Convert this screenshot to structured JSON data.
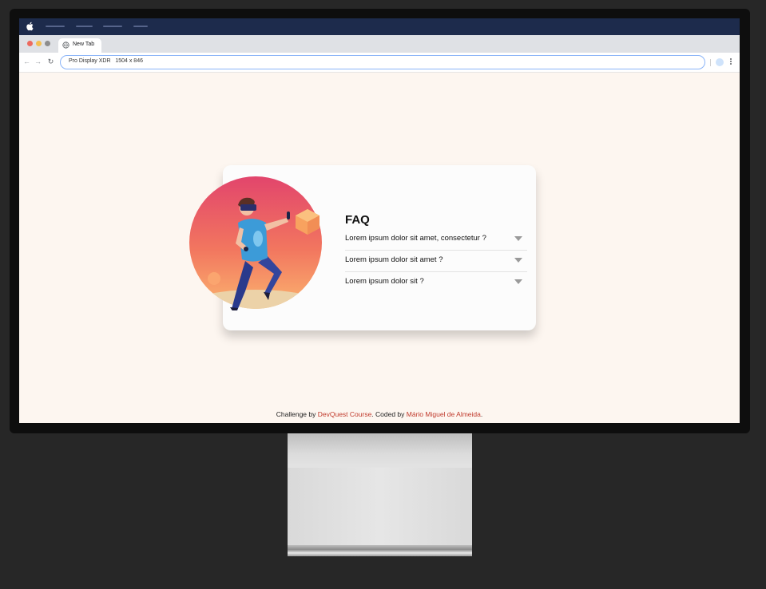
{
  "browser": {
    "tab_title": "New Tab",
    "address": "Pro Display XDR   1504 x 846"
  },
  "faq": {
    "title": "FAQ",
    "items": [
      {
        "question": "Lorem ipsum dolor sit amet, consectetur ?"
      },
      {
        "question": "Lorem ipsum dolor sit amet ?"
      },
      {
        "question": "Lorem ipsum dolor sit ?"
      }
    ]
  },
  "footer": {
    "challenge_prefix": "Challenge by ",
    "challenge_link": "DevQuest Course",
    "coded_prefix": ". Coded by ",
    "author_link": "Mário Miguel de Almeida",
    "suffix": "."
  },
  "icons": [
    "apple-icon",
    "globe-icon",
    "back-icon",
    "forward-icon",
    "reload-icon",
    "extension-icon",
    "kebab-menu-icon",
    "caret-down-icon"
  ],
  "colors": {
    "page_background": "#fdf6f0",
    "link": "#c0392b",
    "os_bar": "#1d2b4c"
  }
}
